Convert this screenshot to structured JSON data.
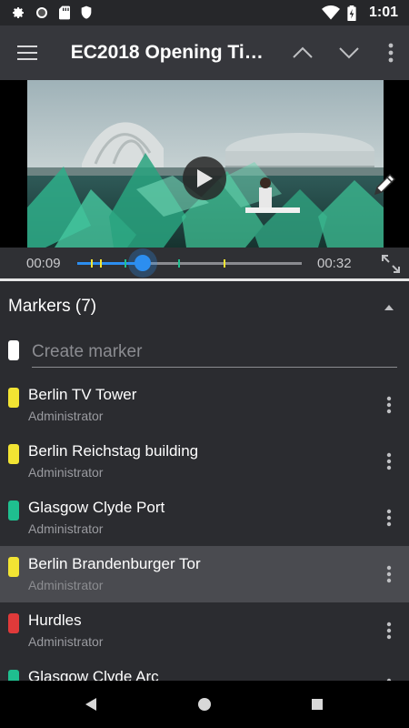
{
  "status_bar": {
    "time": "1:01",
    "icons_left": [
      "gear-icon",
      "circle-icon",
      "sdcard-icon",
      "shield-icon"
    ],
    "icons_right": [
      "wifi-icon",
      "battery-charging-icon"
    ]
  },
  "toolbar": {
    "title": "EC2018 Opening Tit...",
    "icons": [
      "menu-icon",
      "chevron-up-icon",
      "chevron-down-icon",
      "more-vert-icon"
    ]
  },
  "player": {
    "current_time": "00:09",
    "duration": "00:32",
    "progress": 0.29,
    "marker_positions": [
      0.06,
      0.1,
      0.21,
      0.45,
      0.65
    ],
    "marker_colors": [
      "#f2e433",
      "#f2e433",
      "#1fbf8f",
      "#1fbf8f",
      "#f2e433"
    ]
  },
  "markers": {
    "header": "Markers (7)",
    "create_placeholder": "Create marker",
    "items": [
      {
        "title": "Berlin TV Tower",
        "author": "Administrator",
        "color": "#f2e433"
      },
      {
        "title": "Berlin Reichstag building",
        "author": "Administrator",
        "color": "#f2e433"
      },
      {
        "title": "Glasgow Clyde Port",
        "author": "Administrator",
        "color": "#1fbf8f"
      },
      {
        "title": "Berlin Brandenburger Tor",
        "author": "Administrator",
        "color": "#f2e433",
        "selected": true
      },
      {
        "title": "Hurdles",
        "author": "Administrator",
        "color": "#e03a3a"
      },
      {
        "title": "Glasgow Clyde Arc",
        "author": "Administrator",
        "color": "#1fbf8f"
      }
    ]
  },
  "colors": {
    "accent": "#2c8ef0",
    "background": "#2b2c30",
    "toolbar": "#36373c"
  }
}
